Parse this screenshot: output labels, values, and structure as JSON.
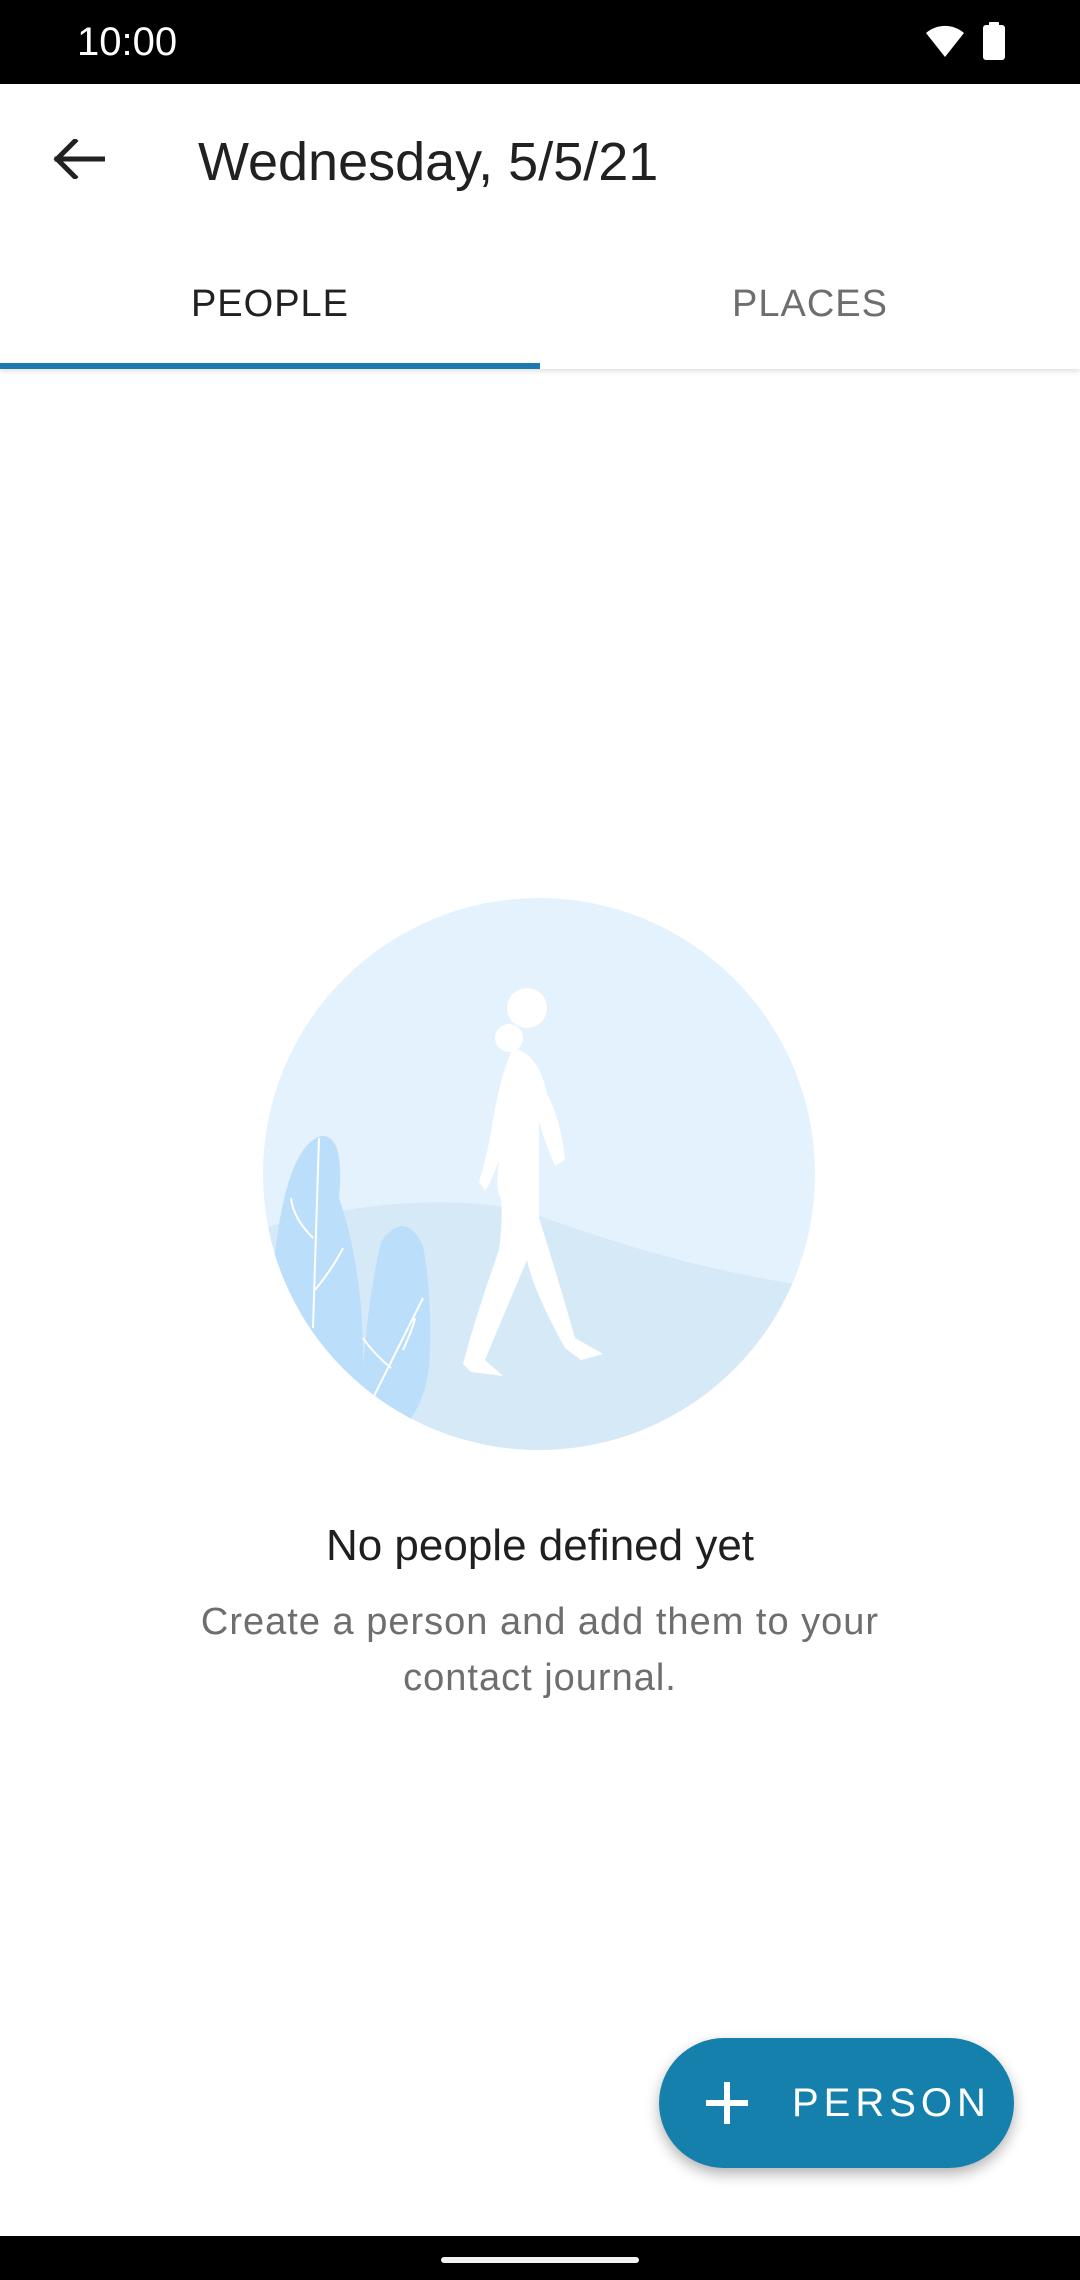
{
  "status_bar": {
    "time": "10:00",
    "icons": [
      "wifi-icon",
      "battery-icon"
    ]
  },
  "app_bar": {
    "back_icon": "arrow-left-icon",
    "title": "Wednesday, 5/5/21"
  },
  "tabs": [
    {
      "label": "PEOPLE",
      "selected": true
    },
    {
      "label": "PLACES",
      "selected": false
    }
  ],
  "empty_state": {
    "illustration": "person-walking-illustration",
    "title": "No people defined yet",
    "description": "Create a person and add them to your contact journal."
  },
  "fab": {
    "icon": "plus-icon",
    "label": "PERSON"
  },
  "colors": {
    "accent": "#1c7ab0",
    "fab": "#1680ad",
    "title_text": "#212121",
    "secondary_text": "#6e6e6e",
    "illustration_light": "#e3f2fd",
    "illustration_mid": "#bbdefb"
  }
}
